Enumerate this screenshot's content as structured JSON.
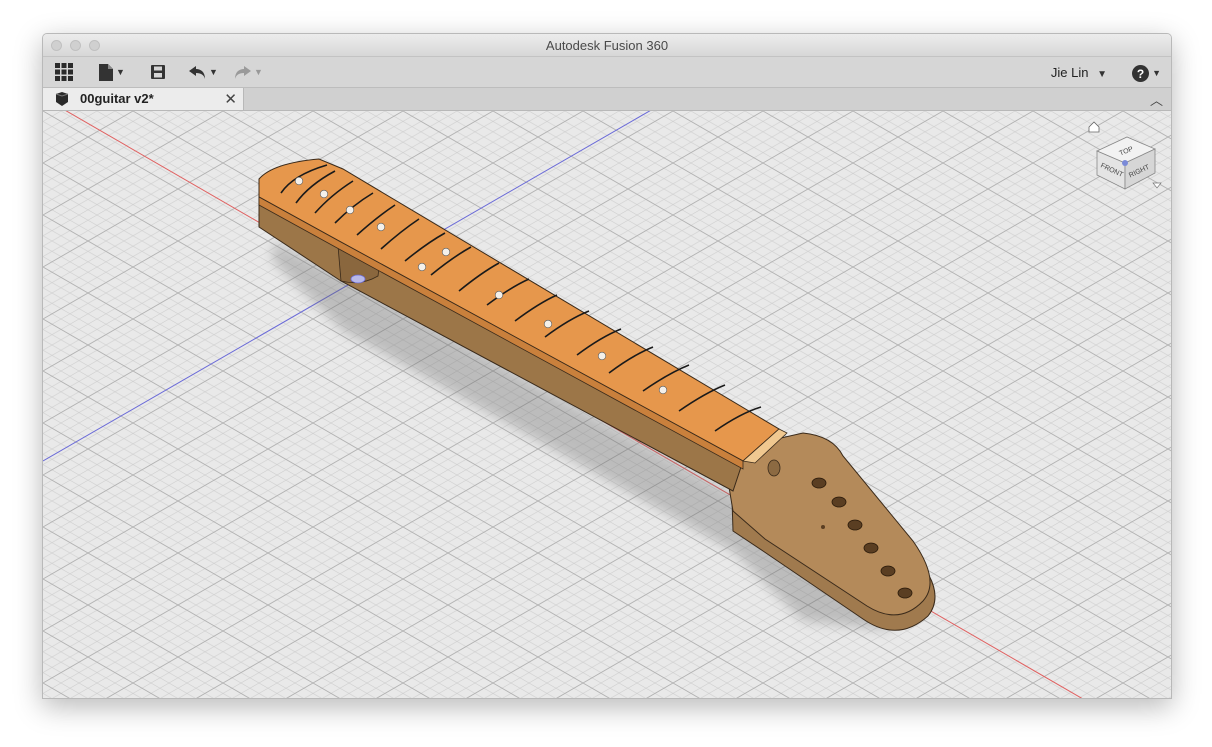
{
  "window": {
    "title": "Autodesk Fusion 360"
  },
  "toolbar": {
    "apps_icon": "grid-icon",
    "file_icon": "file-icon",
    "save_icon": "save-icon",
    "undo_icon": "undo-icon",
    "redo_icon": "redo-icon",
    "user_name": "Jie Lin",
    "help_icon": "help-icon"
  },
  "tabs": [
    {
      "label": "00guitar v2*",
      "icon": "component-icon"
    }
  ],
  "viewcube": {
    "top": "TOP",
    "front": "FRONT",
    "right": "RIGHT"
  },
  "colors": {
    "fretboard": "#e6974c",
    "neck_wood": "#b48a5a",
    "background": "#e8e8e8",
    "x_axis": "#e06060",
    "z_axis": "#6a6ad8"
  }
}
